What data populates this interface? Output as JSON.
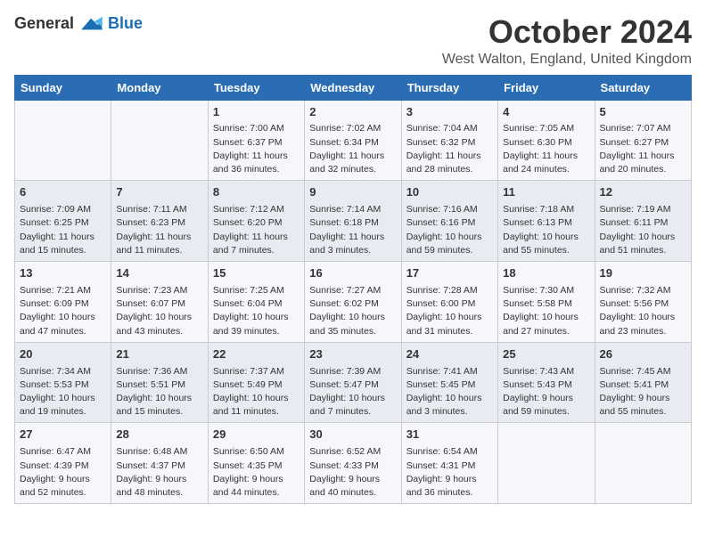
{
  "logo": {
    "general": "General",
    "blue": "Blue"
  },
  "title": "October 2024",
  "location": "West Walton, England, United Kingdom",
  "days_of_week": [
    "Sunday",
    "Monday",
    "Tuesday",
    "Wednesday",
    "Thursday",
    "Friday",
    "Saturday"
  ],
  "weeks": [
    [
      {
        "day": "",
        "info": ""
      },
      {
        "day": "",
        "info": ""
      },
      {
        "day": "1",
        "info": "Sunrise: 7:00 AM\nSunset: 6:37 PM\nDaylight: 11 hours and 36 minutes."
      },
      {
        "day": "2",
        "info": "Sunrise: 7:02 AM\nSunset: 6:34 PM\nDaylight: 11 hours and 32 minutes."
      },
      {
        "day": "3",
        "info": "Sunrise: 7:04 AM\nSunset: 6:32 PM\nDaylight: 11 hours and 28 minutes."
      },
      {
        "day": "4",
        "info": "Sunrise: 7:05 AM\nSunset: 6:30 PM\nDaylight: 11 hours and 24 minutes."
      },
      {
        "day": "5",
        "info": "Sunrise: 7:07 AM\nSunset: 6:27 PM\nDaylight: 11 hours and 20 minutes."
      }
    ],
    [
      {
        "day": "6",
        "info": "Sunrise: 7:09 AM\nSunset: 6:25 PM\nDaylight: 11 hours and 15 minutes."
      },
      {
        "day": "7",
        "info": "Sunrise: 7:11 AM\nSunset: 6:23 PM\nDaylight: 11 hours and 11 minutes."
      },
      {
        "day": "8",
        "info": "Sunrise: 7:12 AM\nSunset: 6:20 PM\nDaylight: 11 hours and 7 minutes."
      },
      {
        "day": "9",
        "info": "Sunrise: 7:14 AM\nSunset: 6:18 PM\nDaylight: 11 hours and 3 minutes."
      },
      {
        "day": "10",
        "info": "Sunrise: 7:16 AM\nSunset: 6:16 PM\nDaylight: 10 hours and 59 minutes."
      },
      {
        "day": "11",
        "info": "Sunrise: 7:18 AM\nSunset: 6:13 PM\nDaylight: 10 hours and 55 minutes."
      },
      {
        "day": "12",
        "info": "Sunrise: 7:19 AM\nSunset: 6:11 PM\nDaylight: 10 hours and 51 minutes."
      }
    ],
    [
      {
        "day": "13",
        "info": "Sunrise: 7:21 AM\nSunset: 6:09 PM\nDaylight: 10 hours and 47 minutes."
      },
      {
        "day": "14",
        "info": "Sunrise: 7:23 AM\nSunset: 6:07 PM\nDaylight: 10 hours and 43 minutes."
      },
      {
        "day": "15",
        "info": "Sunrise: 7:25 AM\nSunset: 6:04 PM\nDaylight: 10 hours and 39 minutes."
      },
      {
        "day": "16",
        "info": "Sunrise: 7:27 AM\nSunset: 6:02 PM\nDaylight: 10 hours and 35 minutes."
      },
      {
        "day": "17",
        "info": "Sunrise: 7:28 AM\nSunset: 6:00 PM\nDaylight: 10 hours and 31 minutes."
      },
      {
        "day": "18",
        "info": "Sunrise: 7:30 AM\nSunset: 5:58 PM\nDaylight: 10 hours and 27 minutes."
      },
      {
        "day": "19",
        "info": "Sunrise: 7:32 AM\nSunset: 5:56 PM\nDaylight: 10 hours and 23 minutes."
      }
    ],
    [
      {
        "day": "20",
        "info": "Sunrise: 7:34 AM\nSunset: 5:53 PM\nDaylight: 10 hours and 19 minutes."
      },
      {
        "day": "21",
        "info": "Sunrise: 7:36 AM\nSunset: 5:51 PM\nDaylight: 10 hours and 15 minutes."
      },
      {
        "day": "22",
        "info": "Sunrise: 7:37 AM\nSunset: 5:49 PM\nDaylight: 10 hours and 11 minutes."
      },
      {
        "day": "23",
        "info": "Sunrise: 7:39 AM\nSunset: 5:47 PM\nDaylight: 10 hours and 7 minutes."
      },
      {
        "day": "24",
        "info": "Sunrise: 7:41 AM\nSunset: 5:45 PM\nDaylight: 10 hours and 3 minutes."
      },
      {
        "day": "25",
        "info": "Sunrise: 7:43 AM\nSunset: 5:43 PM\nDaylight: 9 hours and 59 minutes."
      },
      {
        "day": "26",
        "info": "Sunrise: 7:45 AM\nSunset: 5:41 PM\nDaylight: 9 hours and 55 minutes."
      }
    ],
    [
      {
        "day": "27",
        "info": "Sunrise: 6:47 AM\nSunset: 4:39 PM\nDaylight: 9 hours and 52 minutes."
      },
      {
        "day": "28",
        "info": "Sunrise: 6:48 AM\nSunset: 4:37 PM\nDaylight: 9 hours and 48 minutes."
      },
      {
        "day": "29",
        "info": "Sunrise: 6:50 AM\nSunset: 4:35 PM\nDaylight: 9 hours and 44 minutes."
      },
      {
        "day": "30",
        "info": "Sunrise: 6:52 AM\nSunset: 4:33 PM\nDaylight: 9 hours and 40 minutes."
      },
      {
        "day": "31",
        "info": "Sunrise: 6:54 AM\nSunset: 4:31 PM\nDaylight: 9 hours and 36 minutes."
      },
      {
        "day": "",
        "info": ""
      },
      {
        "day": "",
        "info": ""
      }
    ]
  ]
}
